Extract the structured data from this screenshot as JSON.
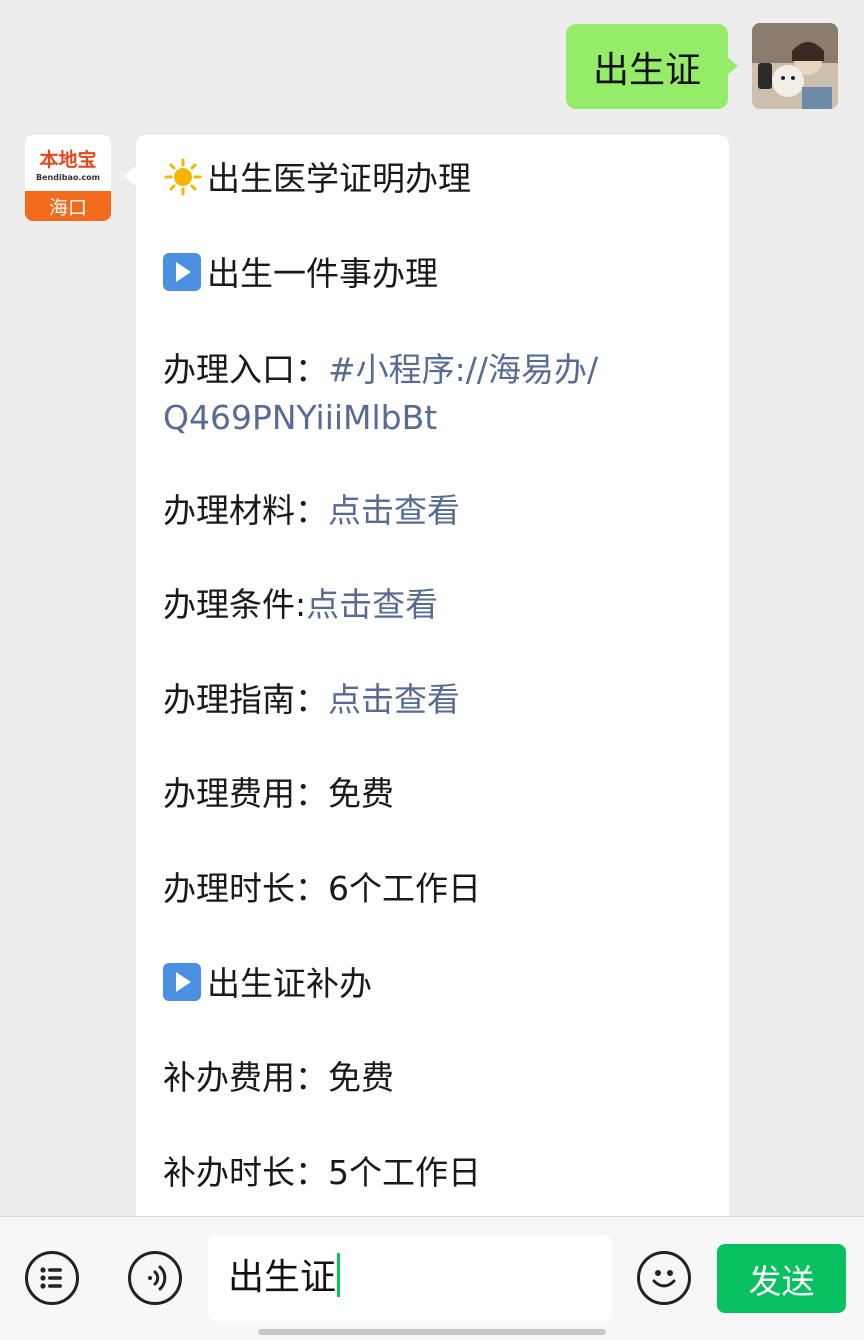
{
  "outgoing": {
    "text": "出生证"
  },
  "incoming": {
    "avatar": {
      "logo_cn": "本地宝",
      "logo_en": "Bendibao.com",
      "city": "海口"
    },
    "lines": [
      {
        "label": "出生医学证明办理"
      },
      {
        "label": "出生一件事办理"
      },
      {
        "label": "办理入口：",
        "link": "#小程序://海易办/",
        "link_cont": "Q469PNYiiiMlbBt"
      },
      {
        "label": "办理材料：",
        "link": "点击查看"
      },
      {
        "label": "办理条件:",
        "link": "点击查看"
      },
      {
        "label": "办理指南：",
        "link": "点击查看"
      },
      {
        "label": "办理费用：",
        "value": "免费"
      },
      {
        "label": "办理时长：",
        "value": "6个工作日"
      },
      {
        "label": "出生证补办"
      },
      {
        "label": "补办费用：",
        "value": "免费"
      },
      {
        "label": "补办时长：",
        "value": "5个工作日"
      }
    ]
  },
  "input_bar": {
    "text": "出生证",
    "send_label": "发送"
  },
  "icons": [
    "menu-list-icon",
    "voice-icon",
    "emoji-icon",
    "sun-icon",
    "play-button-icon"
  ],
  "colors": {
    "bubble_out": "#95ec69",
    "link": "#576b95",
    "send": "#07c160"
  }
}
